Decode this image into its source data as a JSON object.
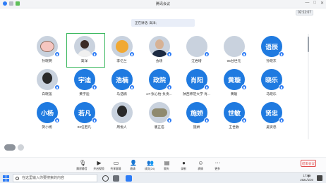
{
  "window": {
    "title": "腾讯会议",
    "controls": [
      "—",
      "□",
      "✕"
    ]
  },
  "timer": "02:11:07",
  "speaking_banner": "正在讲话: 高洋;",
  "participants": [
    [
      {
        "name": "孙晓明",
        "avatar_type": "photo",
        "avatar_desc": "pig-icon",
        "mic": true
      },
      {
        "name": "高洋",
        "avatar_type": "photo",
        "avatar_desc": "person-icon",
        "mic": true,
        "selected": true
      },
      {
        "name": "李忆兰",
        "avatar_type": "photo",
        "avatar_desc": "sun-icon",
        "mic": true
      },
      {
        "name": "会场",
        "avatar_type": "photo",
        "avatar_desc": "man-icon",
        "mic": true
      },
      {
        "name": "江岩增",
        "avatar_type": "photo",
        "avatar_desc": "landscape-icon",
        "mic": true
      },
      {
        "name": "05甘世元",
        "avatar_type": "photo",
        "avatar_desc": "city-icon",
        "mic": true
      },
      {
        "name": "孙晓东",
        "avatar_type": "text",
        "avatar_text": "语辰",
        "mic": true
      }
    ],
    [
      {
        "name": "白晓莲",
        "avatar_type": "photo",
        "avatar_desc": "girl-icon",
        "mic": true
      },
      {
        "name": "黄宇迪",
        "avatar_type": "text",
        "avatar_text": "宇迪",
        "mic": true
      },
      {
        "name": "马浩楠",
        "avatar_type": "text",
        "avatar_text": "浩楠",
        "mic": true
      },
      {
        "name": "o7-张心怡-负责...",
        "avatar_type": "text",
        "avatar_text": "政院",
        "mic": true
      },
      {
        "name": "陕西师范大学 肖...",
        "avatar_type": "text",
        "avatar_text": "肖阳",
        "mic": true
      },
      {
        "name": "黄璇",
        "avatar_type": "text",
        "avatar_text": "黄璇",
        "mic": true
      },
      {
        "name": "马晓乐",
        "avatar_type": "text",
        "avatar_text": "晓乐",
        "mic": true
      }
    ],
    [
      {
        "name": "贺小杨",
        "avatar_type": "text",
        "avatar_text": "小杨",
        "mic": true
      },
      {
        "name": "03任若凡",
        "avatar_type": "text",
        "avatar_text": "若凡",
        "mic": true
      },
      {
        "name": "周悦人",
        "avatar_type": "photo",
        "avatar_desc": "girl-icon",
        "mic": false
      },
      {
        "name": "潘正浩",
        "avatar_type": "photo",
        "avatar_desc": "kids-icon",
        "mic": true
      },
      {
        "name": "施娇",
        "avatar_type": "text",
        "avatar_text": "施娇",
        "mic": true
      },
      {
        "name": "王世敏",
        "avatar_type": "text",
        "avatar_text": "世敏",
        "mic": true
      },
      {
        "name": "吴贤忠",
        "avatar_type": "text",
        "avatar_text": "贤忠",
        "mic": true
      }
    ]
  ],
  "toolbar": {
    "items": [
      {
        "label": "解除静音",
        "icon": "mic-off-icon"
      },
      {
        "label": "开启视频",
        "icon": "camera-off-icon"
      },
      {
        "label": "共享屏幕",
        "icon": "share-screen-icon"
      },
      {
        "label": "邀请",
        "icon": "invite-icon"
      },
      {
        "label": "成员(24)",
        "icon": "members-icon"
      },
      {
        "label": "聊天",
        "icon": "chat-icon"
      },
      {
        "label": "录制",
        "icon": "record-icon"
      },
      {
        "label": "表情",
        "icon": "emoji-icon"
      },
      {
        "label": "更多",
        "icon": "more-icon"
      }
    ],
    "end_label": "结束会议"
  },
  "taskbar": {
    "search_placeholder": "在这里输入你要搜索的内容",
    "time": "17:00",
    "date": "2021/1/20",
    "ime": "中"
  },
  "colors": {
    "accent": "#1f7ae0",
    "selected_border": "#3bb85f",
    "end_red": "#e24c4c"
  }
}
